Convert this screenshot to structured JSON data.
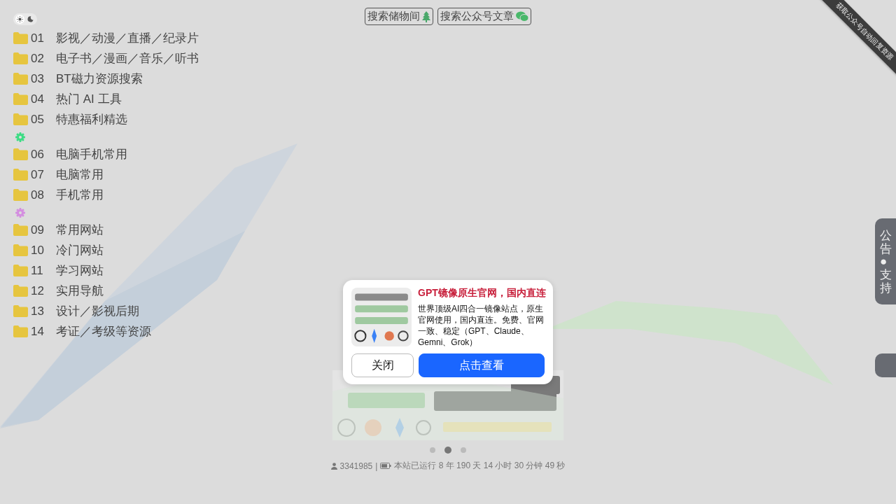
{
  "theme_toggle": {
    "dark": false
  },
  "top_links": [
    {
      "label": "搜索储物间",
      "kind": "tree"
    },
    {
      "label": "搜索公众号文章",
      "kind": "chat"
    }
  ],
  "nav_sections": [
    {
      "items": [
        {
          "number": "01",
          "label": "影视／动漫／直播／纪录片"
        },
        {
          "number": "02",
          "label": "电子书／漫画／音乐／听书"
        },
        {
          "number": "03",
          "label": "BT磁力资源搜索"
        },
        {
          "number": "04",
          "label": "热门 AI 工具"
        },
        {
          "number": "05",
          "label": "特惠福利精选"
        }
      ]
    },
    {
      "color": "#3ddc84",
      "items": [
        {
          "number": "06",
          "label": "电脑手机常用"
        },
        {
          "number": "07",
          "label": "电脑常用"
        },
        {
          "number": "08",
          "label": "手机常用"
        }
      ]
    },
    {
      "color": "#d48ee0",
      "items": [
        {
          "number": "09",
          "label": "常用网站"
        },
        {
          "number": "10",
          "label": "冷门网站"
        },
        {
          "number": "11",
          "label": "学习网站"
        },
        {
          "number": "12",
          "label": "实用导航"
        },
        {
          "number": "13",
          "label": "设计／影视后期"
        },
        {
          "number": "14",
          "label": "考证／考级等资源"
        }
      ]
    }
  ],
  "promo": {
    "title": "GPT镜像原生官网，国内直连",
    "description": "世界顶级AI四合一镜像站点，原生官网使用，国内直连。免费、官网一致、稳定（GPT、Claude、Gemni、Grok）",
    "buttons": [
      {
        "label": "关闭",
        "kind": "secondary"
      },
      {
        "label": "点击查看",
        "kind": "primary"
      }
    ]
  },
  "carousel": {
    "dots": [
      {
        "selected": false
      },
      {
        "selected": true
      },
      {
        "selected": false
      }
    ]
  },
  "footer": {
    "visits": "3341985",
    "separator": "|",
    "uptime": "本站已运行 8 年 190 天 14 小时 30 分钟 49 秒"
  },
  "corner_ribbon": {
    "label": "获取公众号自动回复资源"
  },
  "side_tabs": [
    {
      "kind": "text",
      "label": "公告●支持"
    },
    {
      "kind": "stub"
    }
  ]
}
